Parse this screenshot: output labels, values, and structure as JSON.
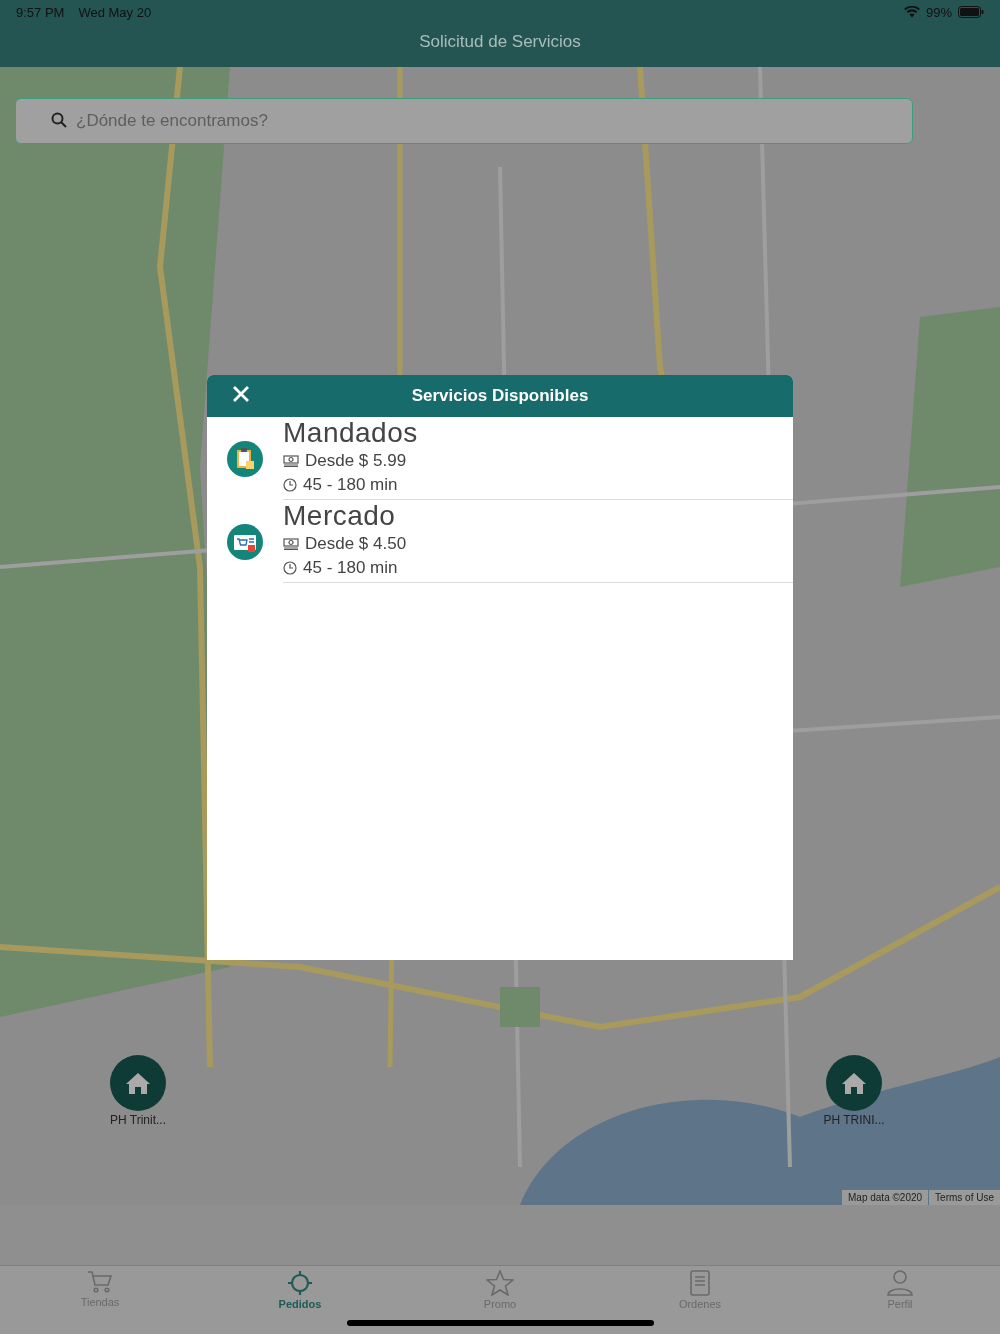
{
  "status_bar": {
    "time": "9:57 PM",
    "date": "Wed May 20",
    "battery": "99%"
  },
  "header": {
    "title": "Solicitud de Servicios"
  },
  "search": {
    "placeholder": "¿Dónde te encontramos?"
  },
  "map": {
    "markers": [
      {
        "label": "PH Trinit..."
      },
      {
        "label": "PH TRINI..."
      }
    ],
    "attribution": [
      "Map data ©2020",
      "Terms of Use"
    ]
  },
  "modal": {
    "title": "Servicios Disponibles",
    "services": [
      {
        "name": "Mandados",
        "price": "Desde $ 5.99",
        "time": "45 - 180 min",
        "kind": "clipboard"
      },
      {
        "name": "Mercado",
        "price": "Desde $ 4.50",
        "time": "45 - 180 min",
        "kind": "cart"
      }
    ]
  },
  "tabs": [
    {
      "label": "Tiendas",
      "kind": "cart",
      "selected": false
    },
    {
      "label": "Pedidos",
      "kind": "target",
      "selected": true
    },
    {
      "label": "Promo",
      "kind": "star",
      "selected": false
    },
    {
      "label": "Ordenes",
      "kind": "doc",
      "selected": false
    },
    {
      "label": "Perfil",
      "kind": "person",
      "selected": false
    }
  ]
}
